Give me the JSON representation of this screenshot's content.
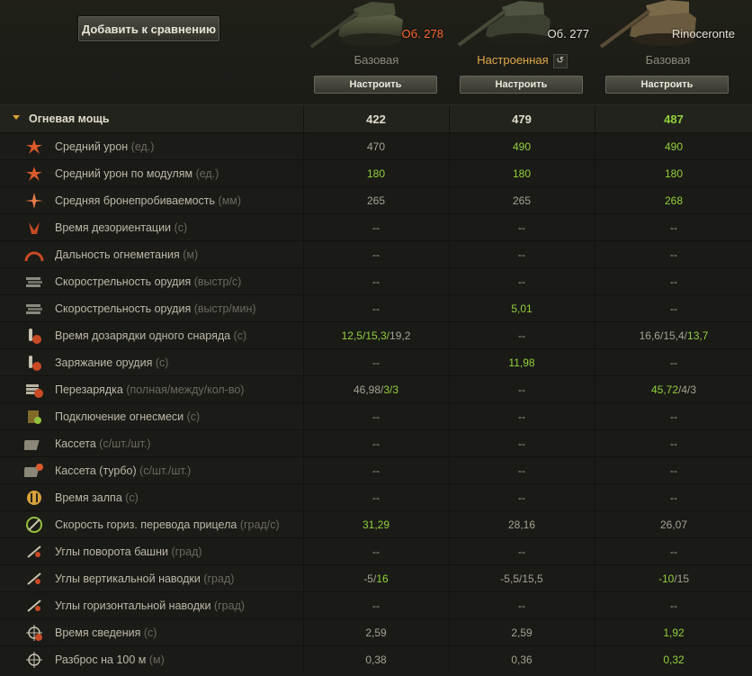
{
  "header": {
    "compare_label": "Добавить к сравнению",
    "tanks": [
      {
        "name": "Об. 278",
        "config": "Базовая",
        "tune_label": "Настроить"
      },
      {
        "name": "Об. 277",
        "config": "Настроенная",
        "tune_label": "Настроить"
      },
      {
        "name": "Rinoceronte",
        "config": "Базовая",
        "tune_label": "Настроить"
      }
    ]
  },
  "section": {
    "title": "Огневая мощь",
    "values": [
      "422",
      "479",
      "487"
    ]
  },
  "rows": [
    {
      "label": "Средний урон",
      "unit": "(ед.)",
      "icon": "damage-icon",
      "values": [
        "470",
        "490",
        "490"
      ]
    },
    {
      "label": "Средний урон по модулям",
      "unit": "(ед.)",
      "icon": "module-damage-icon",
      "values": [
        "180",
        "180",
        "180"
      ]
    },
    {
      "label": "Средняя бронепробиваемость",
      "unit": "(мм)",
      "icon": "penetration-icon",
      "values": [
        "265",
        "265",
        "268"
      ]
    },
    {
      "label": "Время дезориентации",
      "unit": "(с)",
      "icon": "stun-icon",
      "values": [
        "--",
        "--",
        "--"
      ]
    },
    {
      "label": "Дальность огнеметания",
      "unit": "(м)",
      "icon": "flame-range-icon",
      "values": [
        "--",
        "--",
        "--"
      ]
    },
    {
      "label": "Скорострельность орудия",
      "unit": "(выстр/с)",
      "icon": "fire-rate-icon",
      "values": [
        "--",
        "--",
        "--"
      ]
    },
    {
      "label": "Скорострельность орудия",
      "unit": "(выстр/мин)",
      "icon": "fire-rate-min-icon",
      "values": [
        "--",
        "5,01",
        "--"
      ]
    },
    {
      "label": "Время дозарядки одного снаряда",
      "unit": "(с)",
      "icon": "shell-reload-icon",
      "values": [
        "12,5/15,3/19,2",
        "--",
        "16,6/15,4/13,7"
      ]
    },
    {
      "label": "Заряжание орудия",
      "unit": "(с)",
      "icon": "loading-icon",
      "values": [
        "--",
        "11,98",
        "--"
      ]
    },
    {
      "label": "Перезарядка",
      "unit": "(полная/между/кол-во)",
      "icon": "reload-icon",
      "values": [
        "46,98/3/3",
        "--",
        "45,72/4/3"
      ]
    },
    {
      "label": "Подключение огнесмеси",
      "unit": "(с)",
      "icon": "fuel-mix-icon",
      "values": [
        "--",
        "--",
        "--"
      ]
    },
    {
      "label": "Кассета",
      "unit": "(с/шт./шт.)",
      "icon": "magazine-icon",
      "values": [
        "--",
        "--",
        "--"
      ]
    },
    {
      "label": "Кассета (турбо)",
      "unit": "(с/шт./шт.)",
      "icon": "magazine-turbo-icon",
      "values": [
        "--",
        "--",
        "--"
      ]
    },
    {
      "label": "Время залпа",
      "unit": "(с)",
      "icon": "salvo-icon",
      "values": [
        "--",
        "--",
        "--"
      ]
    },
    {
      "label": "Скорость гориз. перевода прицела",
      "unit": "(град/с)",
      "icon": "traverse-icon",
      "values": [
        "31,29",
        "28,16",
        "26,07"
      ]
    },
    {
      "label": "Углы поворота башни",
      "unit": "(град)",
      "icon": "turret-angle-icon",
      "values": [
        "--",
        "--",
        "--"
      ]
    },
    {
      "label": "Углы вертикальной наводки",
      "unit": "(град)",
      "icon": "elevation-icon",
      "values": [
        "-5/16",
        "-5,5/15,5",
        "-10/15"
      ]
    },
    {
      "label": "Углы горизонтальной наводки",
      "unit": "(град)",
      "icon": "horizontal-angle-icon",
      "values": [
        "--",
        "--",
        "--"
      ]
    },
    {
      "label": "Время сведения",
      "unit": "(с)",
      "icon": "aim-time-icon",
      "values": [
        "2,59",
        "2,59",
        "1,92"
      ]
    },
    {
      "label": "Разброс на 100 м",
      "unit": "(м)",
      "icon": "dispersion-icon",
      "values": [
        "0,38",
        "0,36",
        "0,32"
      ]
    }
  ],
  "colors": {
    "highlight": "#93d13b",
    "accent": "#d9a13c",
    "tank_name_red": "#ff6a2b"
  }
}
